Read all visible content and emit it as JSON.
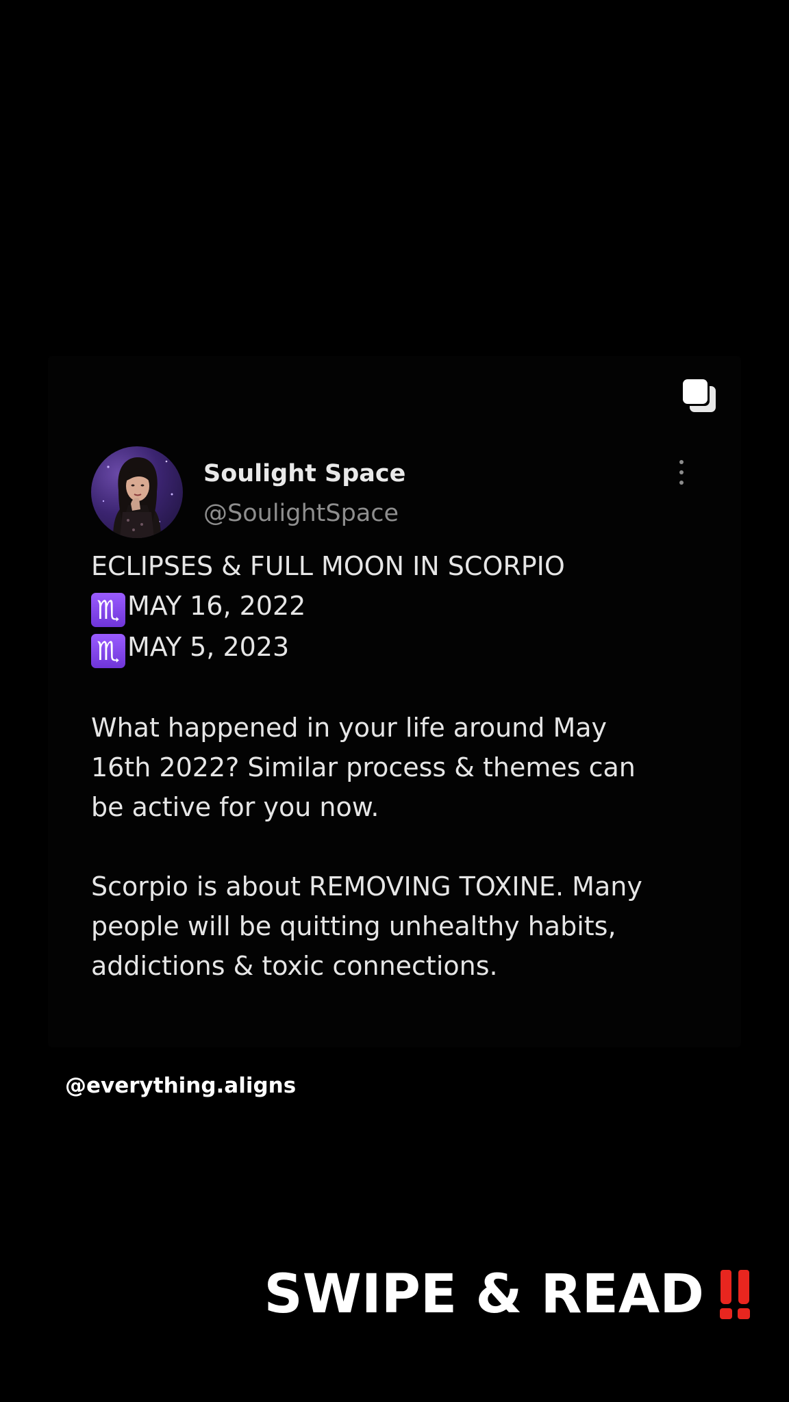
{
  "post": {
    "author_name": "Soulight Space",
    "author_handle": "@SoulightSpace",
    "zodiac_symbol": "♏",
    "lines": {
      "title": "ECLIPSES & FULL MOON IN SCORPIO",
      "date1": "MAY 16, 2022",
      "date2": "MAY 5, 2023",
      "p1_l1": "What happened in your life around May",
      "p1_l2": "16th 2022? Similar process & themes can",
      "p1_l3": "be active for you now.",
      "p2_l1": "Scorpio is about REMOVING TOXINE. Many",
      "p2_l2": "people will be quitting unhealthy habits,",
      "p2_l3": "addictions & toxic connections."
    },
    "icons": {
      "multi_image": "stacked-squares-icon",
      "more": "vertical-ellipsis-icon",
      "zodiac": "scorpio-emoji-icon"
    },
    "colors": {
      "zodiac_badge": "#8a4df0",
      "exclamation": "#e8261f"
    }
  },
  "watermark": "@everything.aligns",
  "cta": {
    "label": "SWIPE & READ",
    "emoji": "‼️"
  }
}
